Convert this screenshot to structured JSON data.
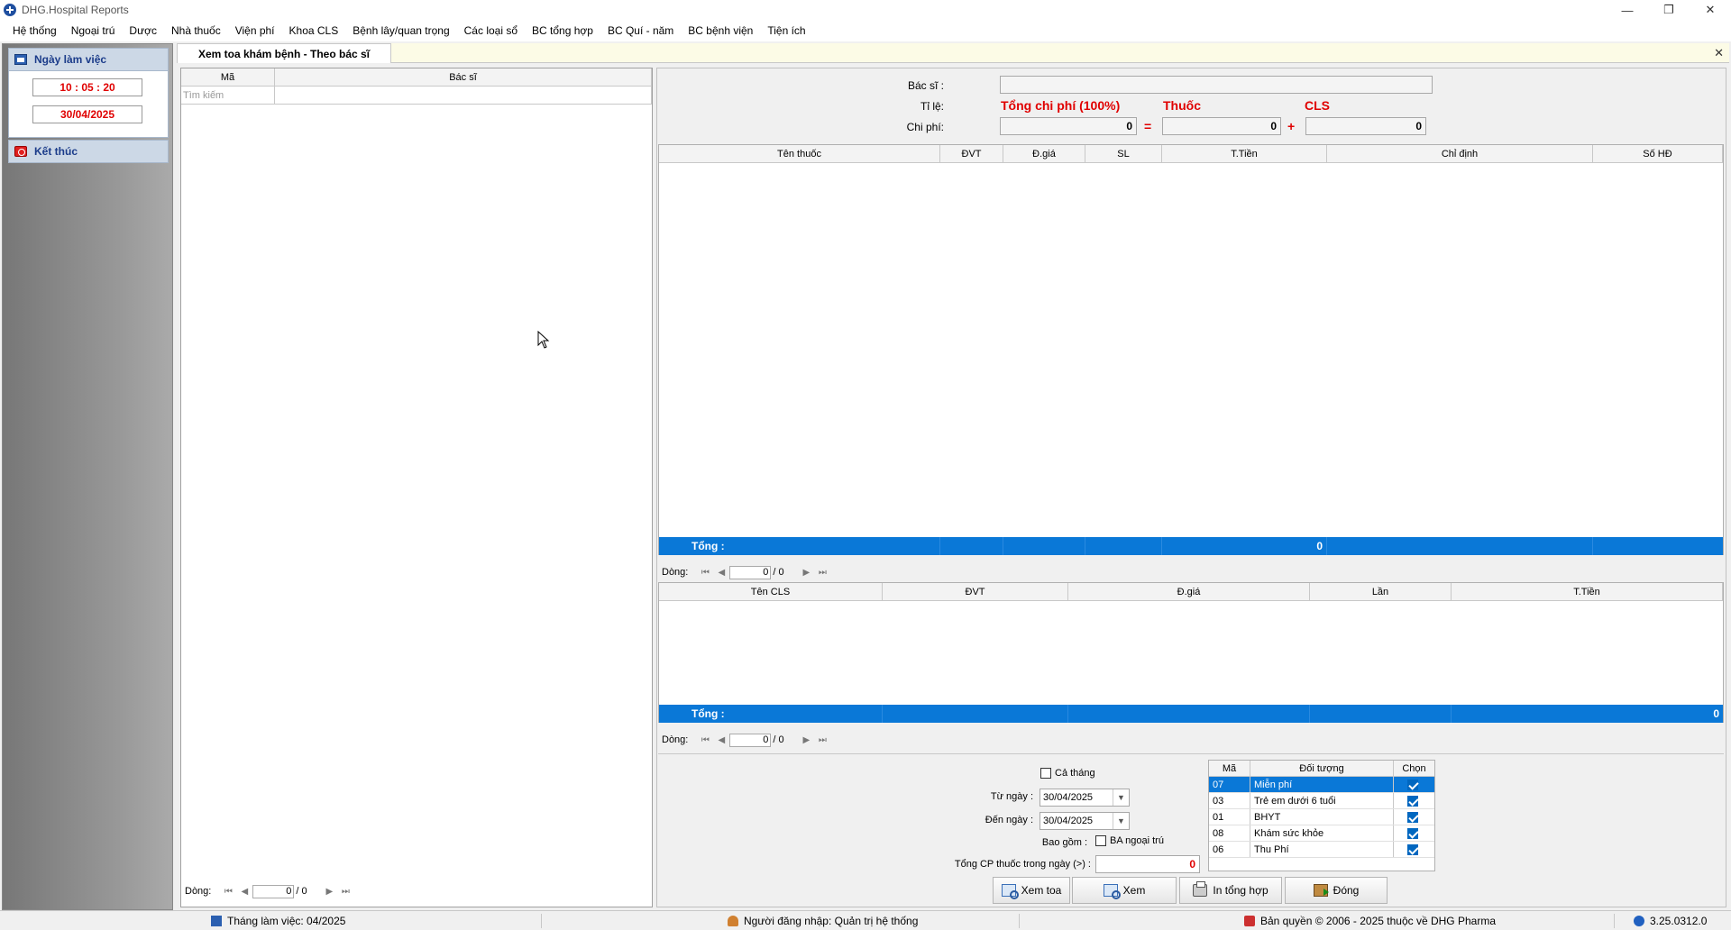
{
  "window": {
    "title": "DHG.Hospital Reports",
    "minimize": "—",
    "maximize": "❐",
    "close": "✕"
  },
  "menu": [
    "Hệ thống",
    "Ngoại trú",
    "Dược",
    "Nhà thuốc",
    "Viện phí",
    "Khoa CLS",
    "Bệnh lây/quan trọng",
    "Các loại sổ",
    "BC tổng hợp",
    "BC Quí - năm",
    "BC bệnh viện",
    "Tiện ích"
  ],
  "leftnav": {
    "workday_label": "Ngày làm việc",
    "time": "10 : 05 : 20",
    "date": "30/04/2025",
    "exit_label": "Kết thúc"
  },
  "doc_tab": {
    "title": "Xem toa khám bệnh - Theo bác sĩ",
    "close": "✕"
  },
  "list": {
    "columns": [
      "Mã",
      "Bác sĩ"
    ],
    "filter_placeholder": "Tìm kiếm",
    "pager": {
      "label": "Dòng:",
      "current": "0",
      "total": "/ 0"
    }
  },
  "summary": {
    "doctor_label": "Bác sĩ :",
    "doctor_value": "",
    "ratio_label": "Tỉ lệ:",
    "total_title": "Tổng chi phí (100%)",
    "drug_title": "Thuốc",
    "cls_title": "CLS",
    "cost_label": "Chi phí:",
    "total_value": "0",
    "eq": "=",
    "drug_value": "0",
    "plus": "+",
    "cls_value": "0"
  },
  "drug_grid": {
    "columns": [
      "Tên thuốc",
      "ĐVT",
      "Đ.giá",
      "SL",
      "T.Tiền",
      "Chỉ định",
      "Số HĐ"
    ],
    "total_label": "Tổng :",
    "total_value": "0",
    "pager": {
      "label": "Dòng:",
      "current": "0",
      "total": "/ 0"
    }
  },
  "cls_grid": {
    "columns": [
      "Tên CLS",
      "ĐVT",
      "Đ.giá",
      "Lần",
      "T.Tiền"
    ],
    "total_label": "Tổng :",
    "total_value": "0",
    "pager": {
      "label": "Dòng:",
      "current": "0",
      "total": "/ 0"
    }
  },
  "filters": {
    "whole_month": "Cả tháng",
    "from_label": "Từ ngày :",
    "from_value": "30/04/2025",
    "to_label": "Đến ngày :",
    "to_value": "30/04/2025",
    "include_label": "Bao gồm :",
    "outpatient": "BA ngoại trú",
    "daily_cost_label": "Tổng CP thuốc trong ngày (>) :",
    "daily_cost_value": "0"
  },
  "objects": {
    "columns": [
      "Mã",
      "Đối tượng",
      "Chọn"
    ],
    "rows": [
      {
        "code": "07",
        "name": "Miễn phí",
        "checked": true
      },
      {
        "code": "03",
        "name": "Trẻ em dưới 6 tuổi",
        "checked": true
      },
      {
        "code": "01",
        "name": "BHYT",
        "checked": true
      },
      {
        "code": "08",
        "name": "Khám sức khỏe",
        "checked": true
      },
      {
        "code": "06",
        "name": "Thu Phí",
        "checked": true
      }
    ]
  },
  "actions": {
    "view_rx": "Xem toa",
    "view": "Xem",
    "print_summary": "In tổng hợp",
    "close": "Đóng"
  },
  "status": {
    "month": "Tháng làm việc: 04/2025",
    "user": "Người đăng nhập: Quản trị hệ thống",
    "copyright": "Bản quyền © 2006 - 2025 thuộc về DHG Pharma",
    "version": "3.25.0312.0"
  },
  "colors": {
    "accent": "#0a78d7",
    "alert": "#e00000"
  }
}
